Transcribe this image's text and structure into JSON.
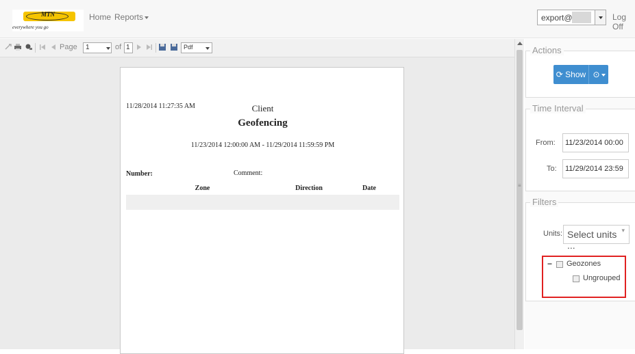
{
  "navbar": {
    "logo": {
      "brand": "MTN",
      "tagline": "everywhere you go"
    },
    "links": [
      {
        "label": "Home"
      },
      {
        "label": "Reports"
      }
    ],
    "user": {
      "value": "export@"
    },
    "logoff": "Log Off"
  },
  "toolbar": {
    "page_label": "Page",
    "page_value": "1",
    "of_label": "of",
    "total_pages": "1",
    "format_value": "Pdf"
  },
  "report": {
    "timestamp": "11/28/2014 11:27:35 AM",
    "client": "Client",
    "title": "Geofencing",
    "range": "11/23/2014 12:00:00 AM - 11/29/2014 11:59:59 PM",
    "number_label": "Number:",
    "comment_label": "Comment:",
    "columns": [
      "Zone",
      "Direction",
      "Date"
    ]
  },
  "panel": {
    "actions": {
      "legend": "Actions",
      "show_label": "Show"
    },
    "time": {
      "legend": "Time Interval",
      "from_label": "From:",
      "from_value": "11/23/2014 00:00",
      "to_label": "To:",
      "to_value": "11/29/2014 23:59"
    },
    "filters": {
      "legend": "Filters",
      "units_label": "Units:",
      "units_value": "Select units ...",
      "tree": {
        "root": "Geozones",
        "child": "Ungrouped"
      }
    }
  },
  "colors": {
    "accent": "#3f8ed0",
    "highlight": "#e02020",
    "brand": "#f5c400"
  }
}
